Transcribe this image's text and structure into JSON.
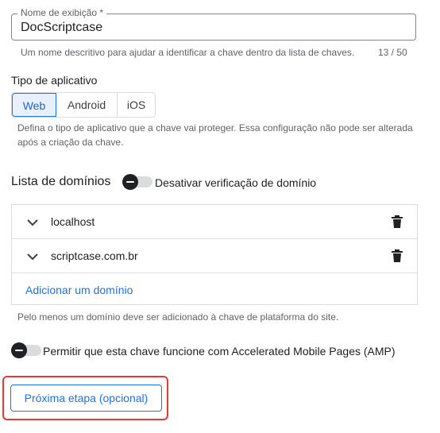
{
  "display_name": {
    "label": "Nome de exibição *",
    "value": "DocScriptcase",
    "helper": "Um nome descritivo para ajudar a identificar a chave dentro da lista de chaves.",
    "counter": "13 / 50"
  },
  "app_type": {
    "title": "Tipo de aplicativo",
    "options": [
      "Web",
      "Android",
      "iOS"
    ],
    "selected": "Web",
    "helper_line1": "Defina o tipo de aplicativo que a chave vai proteger. Essa configuração não pode ser alterada",
    "helper_line2": "após a criação da chave."
  },
  "domains": {
    "title": "Lista de domínios",
    "toggle_label": "Desativar verificação de domínio",
    "items": [
      {
        "name": "localhost"
      },
      {
        "name": "scriptcase.com.br"
      }
    ],
    "add_label": "Adicionar um domínio",
    "helper": "Pelo menos um domínio deve ser adicionado à chave de plataforma do site."
  },
  "amp": {
    "toggle_label": "Permitir que esta chave funcione com Accelerated Mobile Pages (AMP)"
  },
  "next_button": {
    "label": "Próxima etapa (opcional)"
  },
  "colors": {
    "accent": "#1a73e8",
    "highlight_frame": "#e53935"
  },
  "icons": [
    "chevron-down-icon",
    "trash-icon",
    "toggle-off-icon"
  ]
}
